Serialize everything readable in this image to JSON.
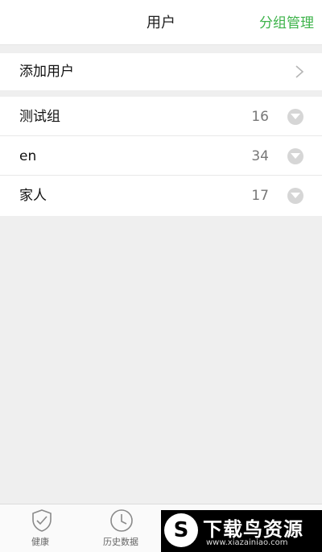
{
  "header": {
    "title": "用户",
    "right_action": "分组管理"
  },
  "add_user": {
    "label": "添加用户"
  },
  "groups": [
    {
      "name": "测试组",
      "count": "16"
    },
    {
      "name": "en",
      "count": "34"
    },
    {
      "name": "家人",
      "count": "17"
    }
  ],
  "tabbar": {
    "items": [
      {
        "label": "健康",
        "icon": "shield-check-icon"
      },
      {
        "label": "历史数据",
        "icon": "clock-icon"
      }
    ]
  },
  "watermark": {
    "title": "下载鸟资源",
    "url": "www.xiazainiao.com",
    "logo_glyph": "S"
  },
  "colors": {
    "accent": "#3db34a",
    "background": "#efefef"
  }
}
